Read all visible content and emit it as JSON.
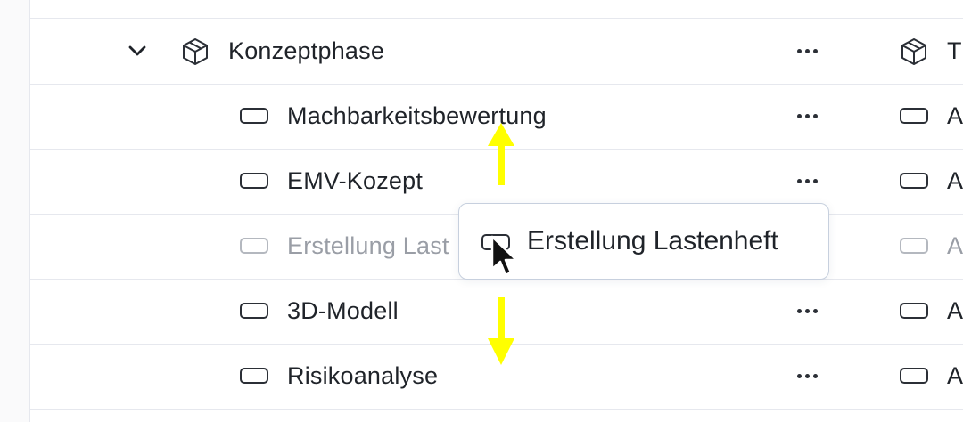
{
  "tree": {
    "parent": {
      "label": "Konzeptphase",
      "column2_text": "T"
    },
    "children": [
      {
        "label": "Machbarkeitsbewertung",
        "column2_text": "A"
      },
      {
        "label": "EMV-Kozept",
        "column2_text": "A"
      },
      {
        "label": "Erstellung Last",
        "column2_text": "A",
        "state": "dragging-placeholder"
      },
      {
        "label": "3D-Modell",
        "column2_text": "A"
      },
      {
        "label": "Risikoanalyse",
        "column2_text": "A"
      }
    ]
  },
  "drag_preview": {
    "label": "Erstellung Lastenheft"
  },
  "icons": {
    "expand": "chevron-down-icon",
    "package": "package-icon",
    "item": "rectangle-icon",
    "more": "more-horizontal-icon",
    "cursor": "mouse-pointer-icon",
    "drag_hint": "move-vertical-arrows-icon"
  },
  "colors": {
    "text": "#1f2329",
    "muted_text": "#9a9ea6",
    "divider": "#e6e8ee",
    "card_border": "#c7d0de",
    "drag_arrow": "#ffff00"
  }
}
